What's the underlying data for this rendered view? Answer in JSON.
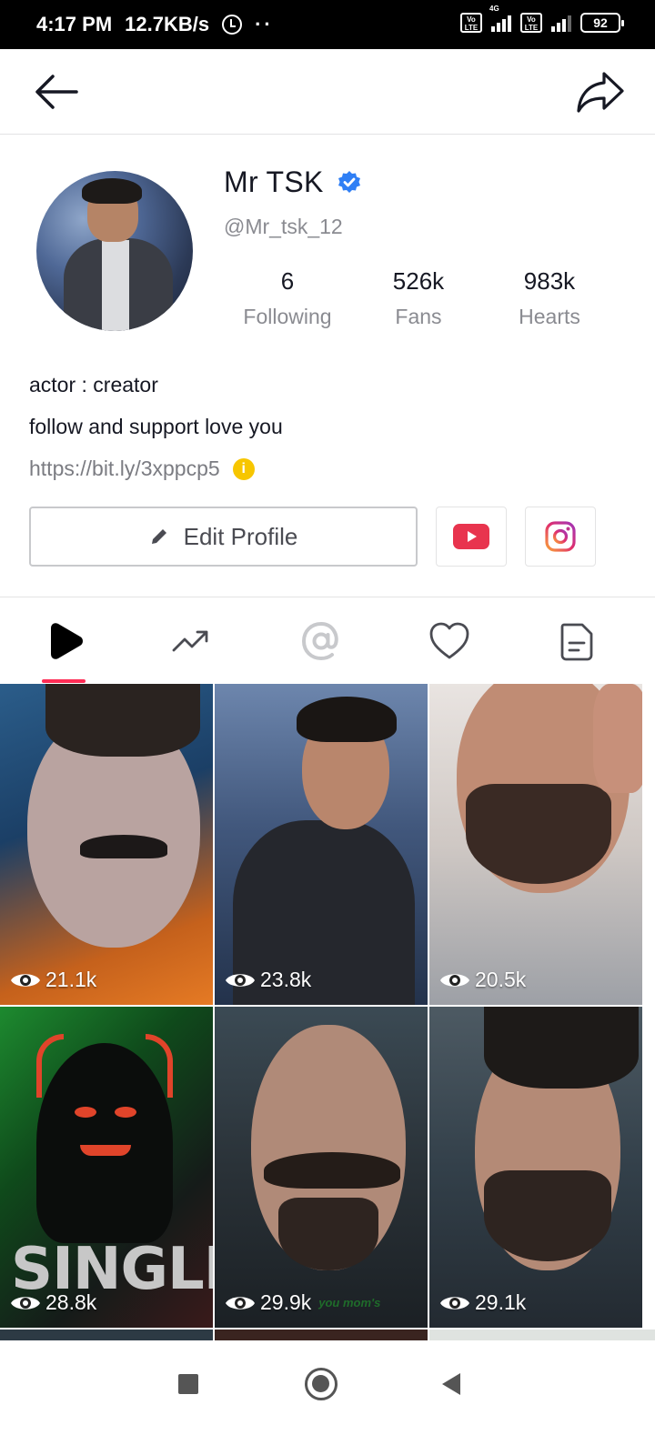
{
  "status_bar": {
    "time": "4:17 PM",
    "speed": "12.7KB/s",
    "dots": "··",
    "network_tag": "4G",
    "volte_label": "Vo LTE",
    "battery": "92"
  },
  "profile": {
    "name": "Mr TSK",
    "handle": "@Mr_tsk_12",
    "stats": [
      {
        "value": "6",
        "label": "Following"
      },
      {
        "value": "526k",
        "label": "Fans"
      },
      {
        "value": "983k",
        "label": "Hearts"
      }
    ],
    "bio_line1": "actor : creator",
    "bio_line2": "follow and support love you",
    "link": "https://bit.ly/3xppcp5",
    "info_glyph": "i",
    "edit_label": "Edit Profile"
  },
  "tabs": [
    {
      "icon": "play-icon",
      "active": true
    },
    {
      "icon": "trending-icon",
      "active": false
    },
    {
      "icon": "at-icon",
      "active": false
    },
    {
      "icon": "heart-icon",
      "active": false
    },
    {
      "icon": "document-icon",
      "active": false
    }
  ],
  "videos": [
    {
      "views": "21.1k"
    },
    {
      "views": "23.8k"
    },
    {
      "views": "20.5k"
    },
    {
      "views": "28.8k",
      "overlay_text": "SINGLE"
    },
    {
      "views": "29.9k",
      "overlay_text": "you mom's"
    },
    {
      "views": "29.1k"
    }
  ],
  "colors": {
    "accent": "#fe2c55",
    "verified": "#20d5ec",
    "verified_badge": "#2f7ff5",
    "youtube": "#e8344e",
    "info": "#f7c600"
  }
}
